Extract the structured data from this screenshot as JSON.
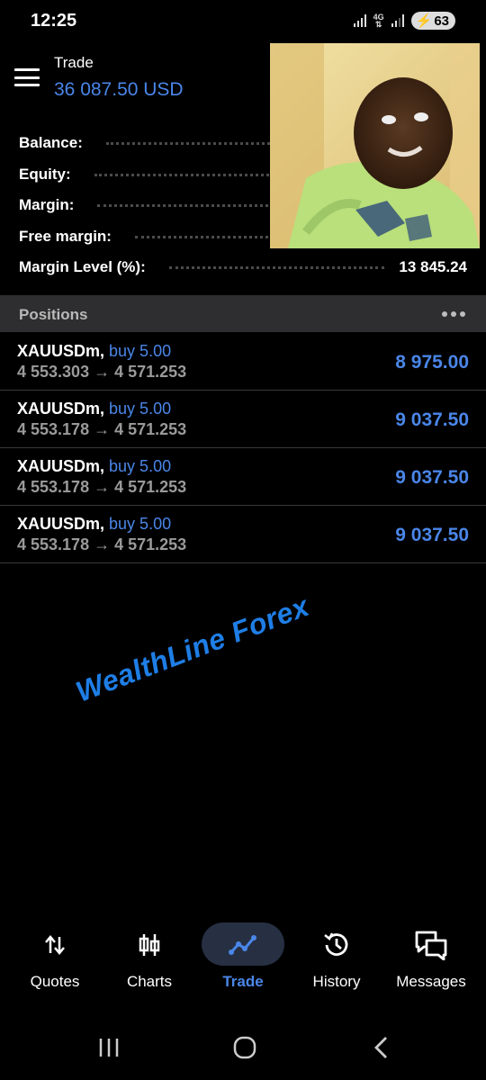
{
  "status_bar": {
    "time": "12:25",
    "network": "4G",
    "battery": "63"
  },
  "header": {
    "title": "Trade",
    "balance": "36 087.50 USD"
  },
  "summary": [
    {
      "label": "Balance:",
      "value": ""
    },
    {
      "label": "Equity:",
      "value": ""
    },
    {
      "label": "Margin:",
      "value": ""
    },
    {
      "label": "Free margin:",
      "value": ""
    },
    {
      "label": "Margin Level (%):",
      "value": "13 845.24"
    }
  ],
  "positions": {
    "title": "Positions",
    "items": [
      {
        "symbol": "XAUUSDm,",
        "side": "buy 5.00",
        "prices": "4 553.303 → 4 571.253",
        "profit": "8 975.00"
      },
      {
        "symbol": "XAUUSDm,",
        "side": "buy 5.00",
        "prices": "4 553.178 → 4 571.253",
        "profit": "9 037.50"
      },
      {
        "symbol": "XAUUSDm,",
        "side": "buy 5.00",
        "prices": "4 553.178 → 4 571.253",
        "profit": "9 037.50"
      },
      {
        "symbol": "XAUUSDm,",
        "side": "buy 5.00",
        "prices": "4 553.178 → 4 571.253",
        "profit": "9 037.50"
      }
    ]
  },
  "watermark": "WealthLine Forex",
  "bottom_nav": [
    {
      "label": "Quotes",
      "icon": "quotes-icon"
    },
    {
      "label": "Charts",
      "icon": "charts-icon"
    },
    {
      "label": "Trade",
      "icon": "trade-icon",
      "active": true
    },
    {
      "label": "History",
      "icon": "history-icon"
    },
    {
      "label": "Messages",
      "icon": "messages-icon"
    }
  ],
  "colors": {
    "accent": "#4a86e8",
    "background": "#000000",
    "section_header": "#2e2e30",
    "muted_text": "#9a9a9a",
    "watermark": "#1e7ee6"
  }
}
